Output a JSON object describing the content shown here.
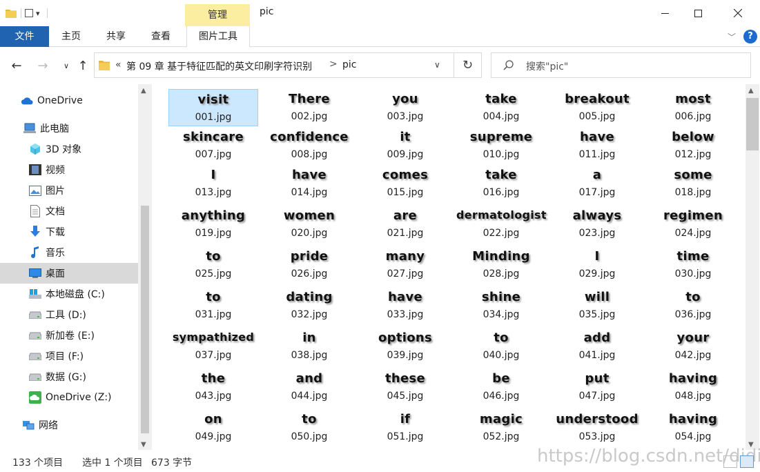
{
  "window": {
    "title": "pic",
    "manage_tab": "管理"
  },
  "ribbon": {
    "tabs": [
      "文件",
      "主页",
      "共享",
      "查看",
      "图片工具"
    ]
  },
  "address": {
    "prefix": "«",
    "crumbs": [
      "第 09 章 基于特征匹配的英文印刷字符识别",
      "pic"
    ],
    "separator": ">"
  },
  "search": {
    "placeholder": "搜索\"pic\""
  },
  "sidebar": {
    "items": [
      {
        "label": "OneDrive",
        "icon": "cloud-icon"
      },
      {
        "label": "此电脑",
        "icon": "computer-icon"
      },
      {
        "label": "3D 对象",
        "icon": "cube-icon"
      },
      {
        "label": "视频",
        "icon": "film-icon"
      },
      {
        "label": "图片",
        "icon": "picture-icon"
      },
      {
        "label": "文档",
        "icon": "document-icon"
      },
      {
        "label": "下载",
        "icon": "download-icon"
      },
      {
        "label": "音乐",
        "icon": "music-icon"
      },
      {
        "label": "桌面",
        "icon": "desktop-icon"
      },
      {
        "label": "本地磁盘 (C:)",
        "icon": "windows-drive-icon"
      },
      {
        "label": "工具 (D:)",
        "icon": "drive-icon"
      },
      {
        "label": "新加卷 (E:)",
        "icon": "drive-icon"
      },
      {
        "label": "项目 (F:)",
        "icon": "drive-icon"
      },
      {
        "label": "数据 (G:)",
        "icon": "drive-icon"
      },
      {
        "label": "OneDrive (Z:)",
        "icon": "onedrive-drive-icon"
      },
      {
        "label": "网络",
        "icon": "network-icon"
      }
    ],
    "selected": "桌面"
  },
  "files": [
    {
      "word": "visit",
      "name": "001.jpg"
    },
    {
      "word": "There",
      "name": "002.jpg"
    },
    {
      "word": "you",
      "name": "003.jpg"
    },
    {
      "word": "take",
      "name": "004.jpg"
    },
    {
      "word": "breakout",
      "name": "005.jpg"
    },
    {
      "word": "most",
      "name": "006.jpg"
    },
    {
      "word": "skincare",
      "name": "007.jpg"
    },
    {
      "word": "confidence",
      "name": "008.jpg"
    },
    {
      "word": "it",
      "name": "009.jpg"
    },
    {
      "word": "supreme",
      "name": "010.jpg"
    },
    {
      "word": "have",
      "name": "011.jpg"
    },
    {
      "word": "below",
      "name": "012.jpg"
    },
    {
      "word": "I",
      "name": "013.jpg"
    },
    {
      "word": "have",
      "name": "014.jpg"
    },
    {
      "word": "comes",
      "name": "015.jpg"
    },
    {
      "word": "take",
      "name": "016.jpg"
    },
    {
      "word": "a",
      "name": "017.jpg"
    },
    {
      "word": "some",
      "name": "018.jpg"
    },
    {
      "word": "anything",
      "name": "019.jpg"
    },
    {
      "word": "women",
      "name": "020.jpg"
    },
    {
      "word": "are",
      "name": "021.jpg"
    },
    {
      "word": "dermatologist",
      "name": "022.jpg"
    },
    {
      "word": "always",
      "name": "023.jpg"
    },
    {
      "word": "regimen",
      "name": "024.jpg"
    },
    {
      "word": "to",
      "name": "025.jpg"
    },
    {
      "word": "pride",
      "name": "026.jpg"
    },
    {
      "word": "many",
      "name": "027.jpg"
    },
    {
      "word": "Minding",
      "name": "028.jpg"
    },
    {
      "word": "I",
      "name": "029.jpg"
    },
    {
      "word": "time",
      "name": "030.jpg"
    },
    {
      "word": "to",
      "name": "031.jpg"
    },
    {
      "word": "dating",
      "name": "032.jpg"
    },
    {
      "word": "have",
      "name": "033.jpg"
    },
    {
      "word": "shine",
      "name": "034.jpg"
    },
    {
      "word": "will",
      "name": "035.jpg"
    },
    {
      "word": "to",
      "name": "036.jpg"
    },
    {
      "word": "sympathized",
      "name": "037.jpg"
    },
    {
      "word": "in",
      "name": "038.jpg"
    },
    {
      "word": "options",
      "name": "039.jpg"
    },
    {
      "word": "to",
      "name": "040.jpg"
    },
    {
      "word": "add",
      "name": "041.jpg"
    },
    {
      "word": "your",
      "name": "042.jpg"
    },
    {
      "word": "the",
      "name": "043.jpg"
    },
    {
      "word": "and",
      "name": "044.jpg"
    },
    {
      "word": "these",
      "name": "045.jpg"
    },
    {
      "word": "be",
      "name": "046.jpg"
    },
    {
      "word": "put",
      "name": "047.jpg"
    },
    {
      "word": "having",
      "name": "048.jpg"
    },
    {
      "word": "on",
      "name": "049.jpg"
    },
    {
      "word": "to",
      "name": "050.jpg"
    },
    {
      "word": "if",
      "name": "051.jpg"
    },
    {
      "word": "magic",
      "name": "052.jpg"
    },
    {
      "word": "understood",
      "name": "053.jpg"
    },
    {
      "word": "having",
      "name": "054.jpg"
    }
  ],
  "selected_file": "001.jpg",
  "status": {
    "count": "133 个项目",
    "selected": "选中 1 个项目",
    "size": "673 字节"
  },
  "watermark": "https://blog.csdn.net/didi_ya",
  "colors": {
    "file_tab": "#1f63b1",
    "manage_tab": "#fbeea0",
    "selection": "#cce8ff",
    "help": "#1e6bd0"
  }
}
